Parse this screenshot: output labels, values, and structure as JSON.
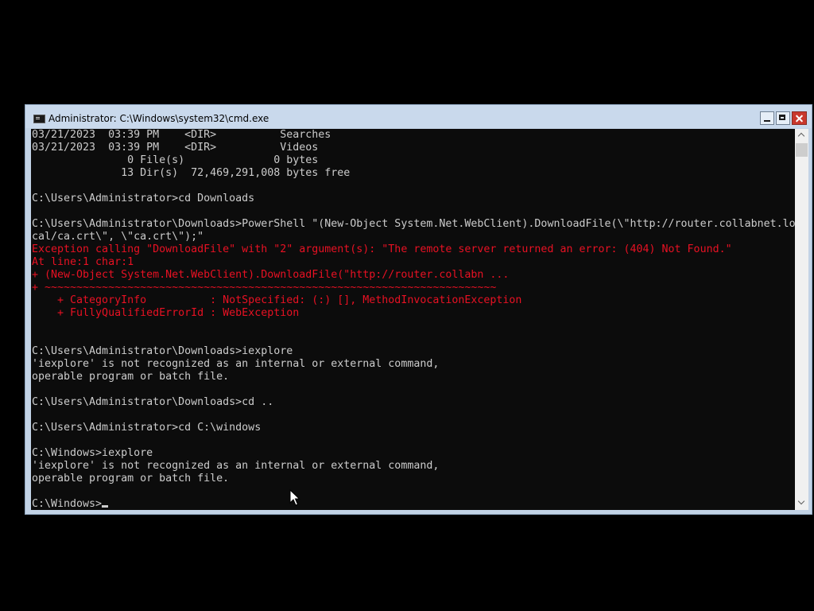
{
  "window": {
    "title": "Administrator: C:\\Windows\\system32\\cmd.exe",
    "controls": {
      "minimize": "minimize",
      "maximize": "maximize",
      "close": "close"
    }
  },
  "console": {
    "colors": {
      "background": "#0c0c0c",
      "text": "#cccccc",
      "error": "#e81123"
    },
    "lines": [
      {
        "text": "03/21/2023  03:39 PM    <DIR>          Searches",
        "style": "normal"
      },
      {
        "text": "03/21/2023  03:39 PM    <DIR>          Videos",
        "style": "normal"
      },
      {
        "text": "               0 File(s)              0 bytes",
        "style": "normal"
      },
      {
        "text": "              13 Dir(s)  72,469,291,008 bytes free",
        "style": "normal"
      },
      {
        "text": "",
        "style": "normal"
      },
      {
        "text": "C:\\Users\\Administrator>cd Downloads",
        "style": "normal"
      },
      {
        "text": "",
        "style": "normal"
      },
      {
        "text": "C:\\Users\\Administrator\\Downloads>PowerShell \"(New-Object System.Net.WebClient).DownloadFile(\\\"http://router.collabnet.lo",
        "style": "normal"
      },
      {
        "text": "cal/ca.crt\\\", \\\"ca.crt\\\");\"",
        "style": "normal"
      },
      {
        "text": "Exception calling \"DownloadFile\" with \"2\" argument(s): \"The remote server returned an error: (404) Not Found.\"",
        "style": "error"
      },
      {
        "text": "At line:1 char:1",
        "style": "error"
      },
      {
        "text": "+ (New-Object System.Net.WebClient).DownloadFile(\"http://router.collabn ...",
        "style": "error"
      },
      {
        "text": "+ ~~~~~~~~~~~~~~~~~~~~~~~~~~~~~~~~~~~~~~~~~~~~~~~~~~~~~~~~~~~~~~~~~~~~~~~",
        "style": "error"
      },
      {
        "text": "    + CategoryInfo          : NotSpecified: (:) [], MethodInvocationException",
        "style": "error"
      },
      {
        "text": "    + FullyQualifiedErrorId : WebException",
        "style": "error"
      },
      {
        "text": "",
        "style": "normal"
      },
      {
        "text": "",
        "style": "normal"
      },
      {
        "text": "C:\\Users\\Administrator\\Downloads>iexplore",
        "style": "normal"
      },
      {
        "text": "'iexplore' is not recognized as an internal or external command,",
        "style": "normal"
      },
      {
        "text": "operable program or batch file.",
        "style": "normal"
      },
      {
        "text": "",
        "style": "normal"
      },
      {
        "text": "C:\\Users\\Administrator\\Downloads>cd ..",
        "style": "normal"
      },
      {
        "text": "",
        "style": "normal"
      },
      {
        "text": "C:\\Users\\Administrator>cd C:\\windows",
        "style": "normal"
      },
      {
        "text": "",
        "style": "normal"
      },
      {
        "text": "C:\\Windows>iexplore",
        "style": "normal"
      },
      {
        "text": "'iexplore' is not recognized as an internal or external command,",
        "style": "normal"
      },
      {
        "text": "operable program or batch file.",
        "style": "normal"
      },
      {
        "text": "",
        "style": "normal"
      }
    ],
    "prompt": "C:\\Windows>"
  }
}
